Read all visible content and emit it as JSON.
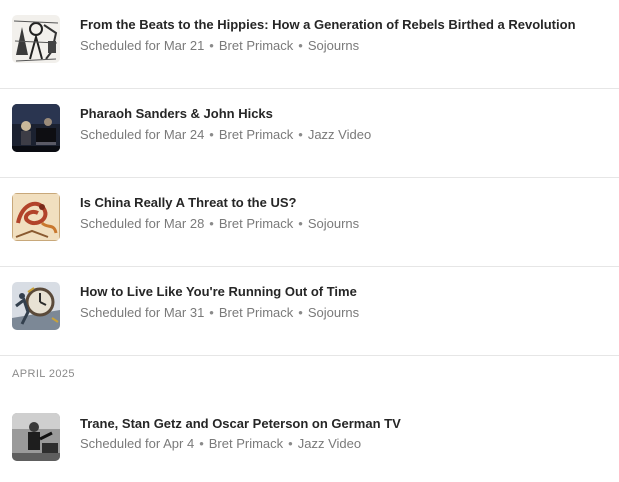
{
  "posts": [
    {
      "title": "From the Beats to the Hippies: How a Generation of Rebels Birthed a Revolution",
      "scheduled": "Scheduled for Mar 21",
      "author": "Bret Primack",
      "section": "Sojourns",
      "thumb": "sketch-illustration-thumbnail"
    },
    {
      "title": "Pharaoh Sanders & John Hicks",
      "scheduled": "Scheduled for Mar 24",
      "author": "Bret Primack",
      "section": "Jazz Video",
      "thumb": "concert-photo-thumbnail"
    },
    {
      "title": "Is China Really A Threat to the US?",
      "scheduled": "Scheduled for Mar 28",
      "author": "Bret Primack",
      "section": "Sojourns",
      "thumb": "dragon-illustration-thumbnail"
    },
    {
      "title": "How to Live Like You're Running Out of Time",
      "scheduled": "Scheduled for Mar 31",
      "author": "Bret Primack",
      "section": "Sojourns",
      "thumb": "clock-illustration-thumbnail"
    }
  ],
  "month_header": "APRIL 2025",
  "april_posts": [
    {
      "title": "Trane, Stan Getz and Oscar Peterson on German TV",
      "scheduled": "Scheduled for Apr 4",
      "author": "Bret Primack",
      "section": "Jazz Video",
      "thumb": "bw-musician-photo-thumbnail"
    }
  ],
  "separator": "•"
}
